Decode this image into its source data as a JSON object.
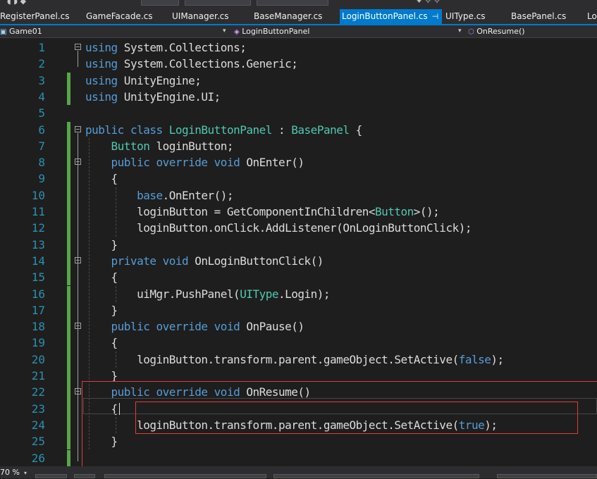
{
  "tabs": [
    {
      "label": "RegisterPanel.cs",
      "active": false
    },
    {
      "label": "GameFacade.cs",
      "active": false
    },
    {
      "label": "UIManager.cs",
      "active": false
    },
    {
      "label": "BaseManager.cs",
      "active": false
    },
    {
      "label": "LoginButtonPanel.cs",
      "active": true
    },
    {
      "label": "UIType.cs",
      "active": false
    },
    {
      "label": "BasePanel.cs",
      "active": false
    },
    {
      "label": "Lo",
      "active": false
    }
  ],
  "active_tab_icons": {
    "pin": "⊣",
    "close": "✕"
  },
  "navbar": {
    "project": "Game01",
    "class_scope": "LoginButtonPanel",
    "member_scope": "OnResume()"
  },
  "code": {
    "line_numbers": [
      "1",
      "2",
      "3",
      "4",
      "5",
      "6",
      "7",
      "8",
      "9",
      "10",
      "11",
      "12",
      "13",
      "14",
      "15",
      "16",
      "17",
      "18",
      "19",
      "20",
      "21",
      "22",
      "23",
      "24",
      "25",
      "26"
    ],
    "lines": [
      [
        [
          "kw",
          "using"
        ],
        [
          "pl",
          " System.Collections;"
        ]
      ],
      [
        [
          "kw",
          "using"
        ],
        [
          "pl",
          " System.Collections.Generic;"
        ]
      ],
      [
        [
          "kw",
          "using"
        ],
        [
          "pl",
          " UnityEngine;"
        ]
      ],
      [
        [
          "kw",
          "using"
        ],
        [
          "pl",
          " UnityEngine.UI;"
        ]
      ],
      [],
      [
        [
          "kw",
          "public"
        ],
        [
          "pl",
          " "
        ],
        [
          "kw",
          "class"
        ],
        [
          "pl",
          " "
        ],
        [
          "ty",
          "LoginButtonPanel"
        ],
        [
          "pl",
          " : "
        ],
        [
          "ty",
          "BasePanel"
        ],
        [
          "pl",
          " {"
        ]
      ],
      [
        [
          "pl",
          "    "
        ],
        [
          "ty",
          "Button"
        ],
        [
          "pl",
          " loginButton;"
        ]
      ],
      [
        [
          "pl",
          "    "
        ],
        [
          "kw",
          "public"
        ],
        [
          "pl",
          " "
        ],
        [
          "kw",
          "override"
        ],
        [
          "pl",
          " "
        ],
        [
          "kw",
          "void"
        ],
        [
          "pl",
          " OnEnter()"
        ]
      ],
      [
        [
          "pl",
          "    {"
        ]
      ],
      [
        [
          "pl",
          "        "
        ],
        [
          "kw",
          "base"
        ],
        [
          "pl",
          ".OnEnter();"
        ]
      ],
      [
        [
          "pl",
          "        loginButton = GetComponentInChildren<"
        ],
        [
          "ty",
          "Button"
        ],
        [
          "pl",
          ">();"
        ]
      ],
      [
        [
          "pl",
          "        loginButton.onClick.AddListener(OnLoginButtonClick);"
        ]
      ],
      [
        [
          "pl",
          "    }"
        ]
      ],
      [
        [
          "pl",
          "    "
        ],
        [
          "kw",
          "private"
        ],
        [
          "pl",
          " "
        ],
        [
          "kw",
          "void"
        ],
        [
          "pl",
          " OnLoginButtonClick()"
        ]
      ],
      [
        [
          "pl",
          "    {"
        ]
      ],
      [
        [
          "pl",
          "        uiMgr.PushPanel("
        ],
        [
          "ty",
          "UIType"
        ],
        [
          "pl",
          ".Login);"
        ]
      ],
      [
        [
          "pl",
          "    }"
        ]
      ],
      [
        [
          "pl",
          "    "
        ],
        [
          "kw",
          "public"
        ],
        [
          "pl",
          " "
        ],
        [
          "kw",
          "override"
        ],
        [
          "pl",
          " "
        ],
        [
          "kw",
          "void"
        ],
        [
          "pl",
          " OnPause()"
        ]
      ],
      [
        [
          "pl",
          "    {"
        ]
      ],
      [
        [
          "pl",
          "        loginButton.transform.parent.gameObject.SetActive("
        ],
        [
          "kw",
          "false"
        ],
        [
          "pl",
          ");"
        ]
      ],
      [
        [
          "pl",
          "    }"
        ]
      ],
      [
        [
          "pl",
          "    "
        ],
        [
          "kw",
          "public"
        ],
        [
          "pl",
          " "
        ],
        [
          "kw",
          "override"
        ],
        [
          "pl",
          " "
        ],
        [
          "kw",
          "void"
        ],
        [
          "pl",
          " OnResume()"
        ]
      ],
      [
        [
          "pl",
          "    {"
        ]
      ],
      [
        [
          "pl",
          "        loginButton.transform.parent.gameObject.SetActive("
        ],
        [
          "kw",
          "true"
        ],
        [
          "pl",
          ");"
        ]
      ],
      [
        [
          "pl",
          "    }"
        ]
      ],
      []
    ],
    "fold_markers_at_lines": [
      1,
      6,
      8,
      14,
      18,
      22
    ],
    "changed_lines": [
      3,
      4,
      6,
      7,
      8,
      9,
      10,
      11,
      12,
      13,
      14,
      15,
      16,
      17,
      18,
      19,
      20,
      21,
      22,
      23,
      24,
      25,
      26
    ]
  },
  "status": {
    "zoom": "70 %"
  },
  "colors": {
    "editor_bg": "#1e1e1e",
    "keyword": "#569cd6",
    "type": "#4ec9b0",
    "plain": "#dcdcdc",
    "line_number": "#2b91af",
    "active_tab": "#007acc",
    "change_bar": "#57a64a",
    "annotation_box": "#e03c3c"
  }
}
